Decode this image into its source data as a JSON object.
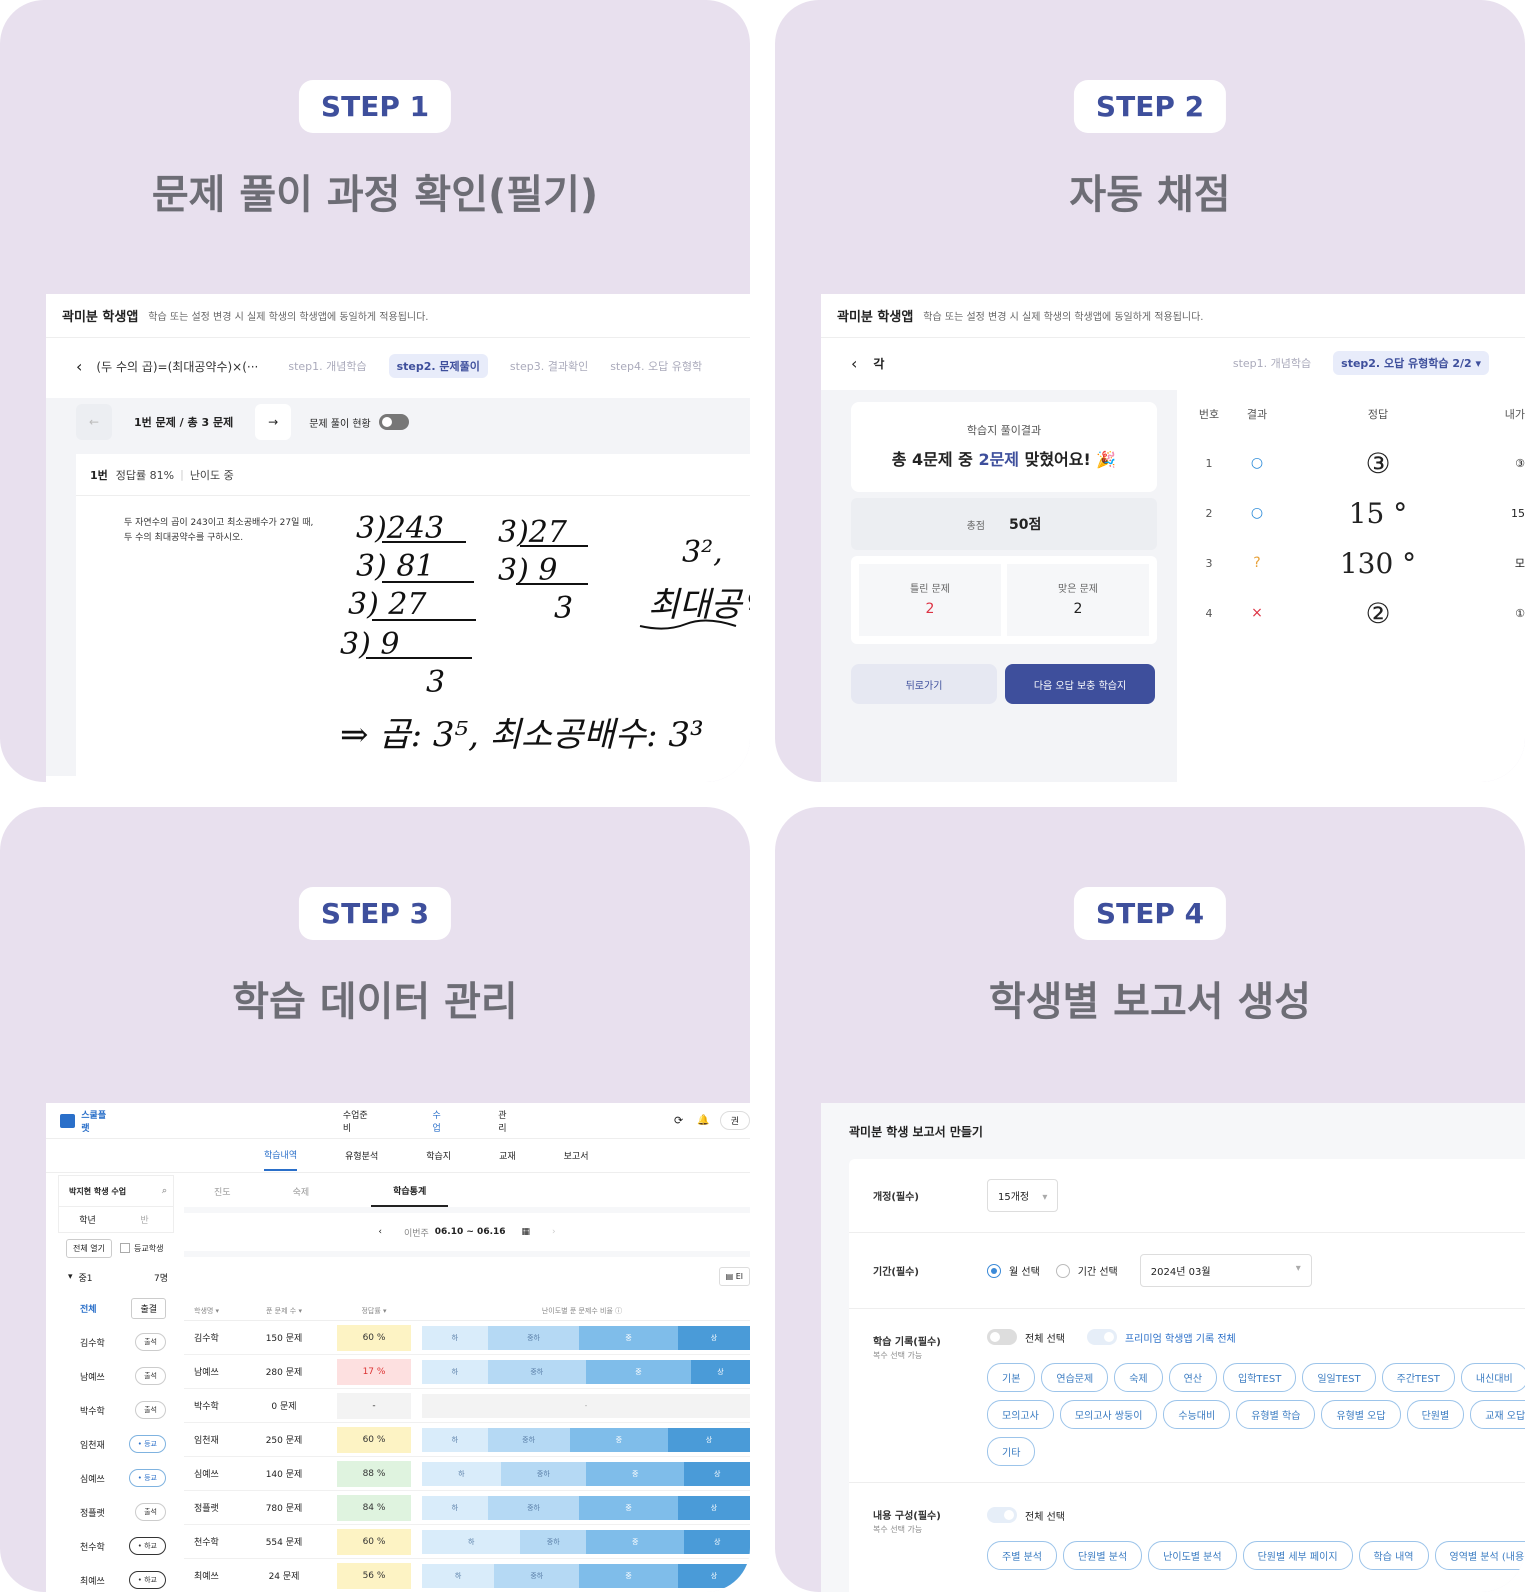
{
  "cards": [
    {
      "step": "STEP 1",
      "title": "문제 풀이 과정 확인(필기)"
    },
    {
      "step": "STEP 2",
      "title": "자동 채점"
    },
    {
      "step": "STEP 3",
      "title": "학습 데이터 관리"
    },
    {
      "step": "STEP 4",
      "title": "학생별 보고서 생성"
    }
  ],
  "app": {
    "name": "곽미분 학생앱",
    "note": "학습 또는 설정 변경 시 실제 학생의 학생앱에 동일하게 적용됩니다."
  },
  "s1": {
    "back": "‹",
    "unit": "(두 수의 곱)=(최대공약수)×(···",
    "steps": [
      "step1. 개념학습",
      "step2. 문제풀이",
      "step3. 결과확인",
      "step4. 오답 유형학"
    ],
    "prev": "←",
    "next": "→",
    "counter": "1번 문제 / 총 3 문제",
    "toggle_label": "문제 풀이 현황",
    "qno": "1번",
    "rate": "정답률 81%",
    "level": "난이도 중",
    "question": [
      "두 자연수의 곱이 243이고 최소공배수가 27일 때,",
      "두 수의 최대공약수를 구하시오."
    ],
    "hand": [
      "3)243",
      "3) 81",
      "3) 27",
      "3)  9",
      "3",
      "3)27",
      "3) 9",
      "3",
      "3²,",
      "최대공약",
      "⇒ 곱: 3⁵, 최소공배수: 3³"
    ]
  },
  "s2": {
    "back": "‹",
    "unit": "각",
    "steps": [
      "step1. 개념학습",
      "step2. 오답 유형학습 2/2 ▾"
    ],
    "result_title": "학습지 풀이결과",
    "result_pre": "총 4문제 중 ",
    "result_hl": "2문제",
    "result_post": " 맞혔어요! 🎉",
    "score_label": "총점",
    "score": "50점",
    "wrong_label": "틀린 문제",
    "wrong": "2",
    "right_label": "맞은 문제",
    "right": "2",
    "back_btn": "뒤로가기",
    "next_btn": "다음 오답 보충 학습지",
    "cols": [
      "번호",
      "결과",
      "정답",
      "내가"
    ],
    "rows": [
      {
        "no": "1",
        "mark": "○",
        "ans": "③",
        "mine": "③"
      },
      {
        "no": "2",
        "mark": "○",
        "ans": "15 °",
        "mine": "15"
      },
      {
        "no": "3",
        "mark": "?",
        "ans": "130 °",
        "mine": "모"
      },
      {
        "no": "4",
        "mark": "×",
        "ans": "②",
        "mine": "①"
      }
    ]
  },
  "s3": {
    "logo": "스쿨플랫",
    "top_nav": [
      "수업준비",
      "수업",
      "관리"
    ],
    "refresh": "⟳",
    "bell": "🔔",
    "user": "권",
    "sub_nav": [
      "학습내역",
      "유형분석",
      "학습지",
      "교재",
      "보고서"
    ],
    "class_name": "박지현 학생 수업",
    "search": "⌕",
    "tabs_a": [
      "학년",
      "반"
    ],
    "open_all": "전체 열기",
    "checkbox_label": "등교학생",
    "grade": "중1",
    "grade_count": "7명",
    "all": "전체",
    "all_btn": "출결",
    "content_tabs": [
      "진도",
      "숙제",
      "학습통계"
    ],
    "week_label": "이번주",
    "week": "06.10 ~ 06.16",
    "print": "▤ El",
    "cols": [
      "학생명 ▾",
      "푼 문제 수 ▾",
      "정답률 ▾",
      "난이도별 푼 문제수 비율 ⓘ"
    ],
    "students": [
      {
        "name": "김수학",
        "count": "150 문제",
        "rate": "60 %",
        "btn": "출석",
        "bar": [
          "하",
          "중하",
          "중",
          "상"
        ]
      },
      {
        "name": "남예쓰",
        "count": "280 문제",
        "rate": "17 %",
        "btn": "출석",
        "bar": [
          "하",
          "중하",
          "중",
          "상"
        ]
      },
      {
        "name": "박수학",
        "count": "0 문제",
        "rate": "-",
        "btn": "출석",
        "bar": [
          "-"
        ]
      },
      {
        "name": "임천재",
        "count": "250 문제",
        "rate": "60 %",
        "btn": "• 등교",
        "bar": [
          "하",
          "중하",
          "중",
          "상"
        ]
      },
      {
        "name": "심예쓰",
        "count": "140 문제",
        "rate": "88 %",
        "btn": "• 등교",
        "bar": [
          "하",
          "중하",
          "중",
          "상"
        ]
      },
      {
        "name": "정플랫",
        "count": "780 문제",
        "rate": "84 %",
        "btn": "출석",
        "bar": [
          "하",
          "중하",
          "중",
          "상"
        ]
      },
      {
        "name": "천수학",
        "count": "554 문제",
        "rate": "60 %",
        "btn": "• 하교",
        "bar": [
          "하",
          "중하",
          "중",
          "상"
        ]
      },
      {
        "name": "최예쓰",
        "count": "24 문제",
        "rate": "56 %",
        "btn": "• 하교",
        "bar": [
          "하",
          "중하",
          "중",
          "상"
        ]
      }
    ]
  },
  "s4": {
    "title": "곽미분 학생 보고서 만들기",
    "rev_label": "개정(필수)",
    "rev_value": "15개정",
    "period_label": "기간(필수)",
    "period_opt1": "월 선택",
    "period_opt2": "기간 선택",
    "period_value": "2024년 03월",
    "rec_label": "학습 기록(필수)",
    "rec_sub": "복수 선택 가능",
    "rec_all": "전체 선택",
    "rec_premium": "프리미엄 학생앱 기록 전체",
    "rec_chips": [
      "기본",
      "연습문제",
      "숙제",
      "연산",
      "입학TEST",
      "일일TEST",
      "주간TEST",
      "내신대비",
      "모의고사",
      "모의고사 쌍둥이",
      "수능대비",
      "유형별 학습",
      "유형별 오답",
      "단원별",
      "교재 오답",
      "기타"
    ],
    "content_label": "내용 구성(필수)",
    "content_sub": "복수 선택 가능",
    "content_all": "전체 선택",
    "content_chips": [
      "주별 분석",
      "단원별 분석",
      "난이도별 분석",
      "단원별 세부 페이지",
      "학습 내역",
      "영역별 분석 (내용 영"
    ]
  }
}
